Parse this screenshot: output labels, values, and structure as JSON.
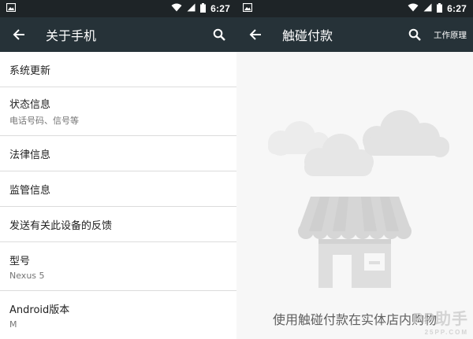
{
  "colors": {
    "statusbar": "#1e2427",
    "appbar": "#263238",
    "divider": "#dcdcdc",
    "illustration": "#d8d8d8"
  },
  "left_screen": {
    "status": {
      "time": "6:27",
      "icons": [
        "image-icon",
        "wifi-icon",
        "signal-icon",
        "battery-icon"
      ]
    },
    "appbar": {
      "title": "关于手机",
      "back_icon": "back-arrow-icon",
      "search_icon": "search-icon"
    },
    "items": [
      {
        "title": "系统更新"
      },
      {
        "title": "状态信息",
        "subtitle": "电话号码、信号等"
      },
      {
        "title": "法律信息"
      },
      {
        "title": "监管信息"
      },
      {
        "title": "发送有关此设备的反馈"
      },
      {
        "title": "型号",
        "subtitle": "Nexus 5"
      },
      {
        "title": "Android版本",
        "subtitle": "M"
      }
    ]
  },
  "right_screen": {
    "status": {
      "time": "6:27",
      "icons": [
        "image-icon",
        "wifi-icon",
        "signal-icon",
        "battery-icon"
      ]
    },
    "appbar": {
      "title": "触碰付款",
      "back_icon": "back-arrow-icon",
      "search_icon": "search-icon",
      "action": "工作原理"
    },
    "empty_message": "使用触碰付款在实体店内购物",
    "illustration": "store-with-clouds",
    "watermark": {
      "main": "PP助手",
      "sub": "25PP.COM"
    }
  }
}
